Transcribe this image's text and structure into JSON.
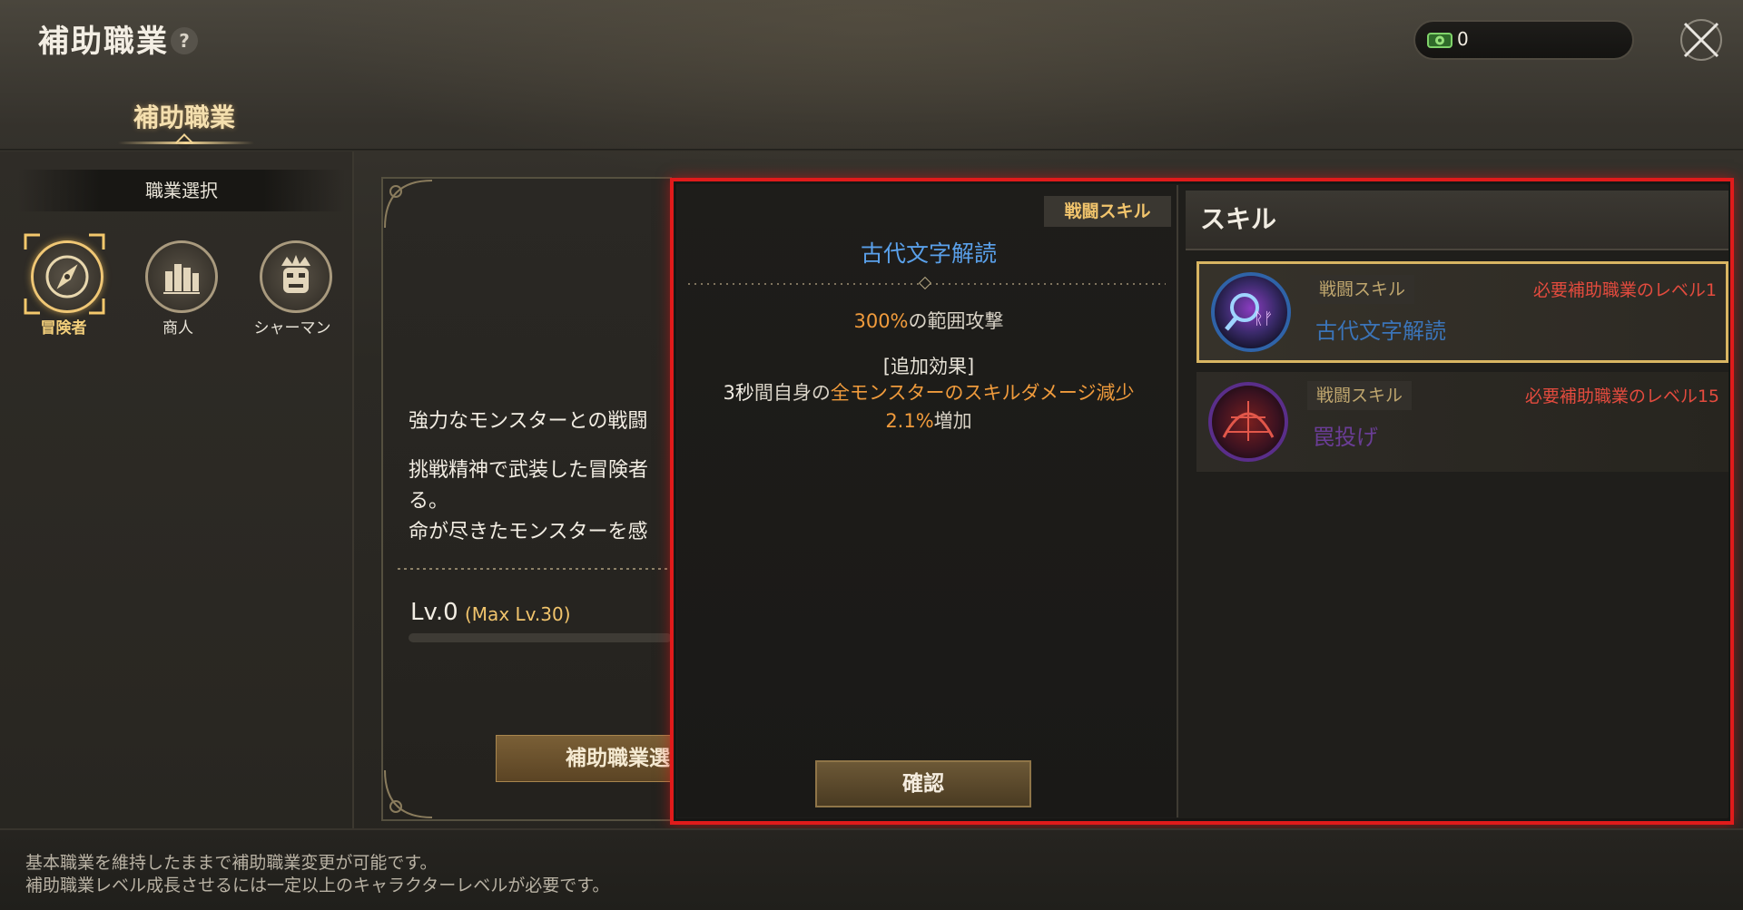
{
  "header": {
    "title": "補助職業",
    "help_symbol": "?",
    "currency_value": "0",
    "tab_label": "補助職業"
  },
  "left": {
    "heading": "職業選択",
    "jobs": [
      {
        "label": "冒険者",
        "selected": true
      },
      {
        "label": "商人",
        "selected": false
      },
      {
        "label": "シャーマン",
        "selected": false
      }
    ]
  },
  "middle": {
    "desc1": "強力なモンスターとの戦闘",
    "desc2": "挑戦精神で武装した冒険者",
    "desc3": "る。",
    "desc4": "命が尽きたモンスターを感",
    "level": "Lv.0",
    "level_max": "(Max Lv.30)",
    "select_button": "補助職業選"
  },
  "detail": {
    "badge": "戦闘スキル",
    "skill_name": "古代文字解読",
    "effect1_highlight": "300%",
    "effect1_rest": "の範囲攻撃",
    "extra_heading": "[追加効果]",
    "effect2_prefix": "3秒",
    "effect2_mid": "間自身の",
    "effect2_highlight": "全モンスターのスキルダメージ減少",
    "effect2_value": "2.1%",
    "effect2_suffix": "増加",
    "confirm_button": "確認"
  },
  "skill_list": {
    "heading": "スキル",
    "items": [
      {
        "badge": "戦闘スキル",
        "requirement": "必要補助職業のレベル1",
        "name": "古代文字解読",
        "name_color": "#3b74b8",
        "selected": true
      },
      {
        "badge": "戦闘スキル",
        "requirement": "必要補助職業のレベル15",
        "name": "罠投げ",
        "name_color": "#6a3d96",
        "selected": false
      }
    ]
  },
  "footer": {
    "line1": "基本職業を維持したままで補助職業変更が可能です。",
    "line2": "補助職業レベル成長させるには一定以上のキャラクターレベルが必要です。"
  },
  "colors": {
    "highlight_border": "#e01b1b",
    "accent_gold": "#f1c46c",
    "orange_text": "#f09b3c",
    "skill_name_blue": "#5aa0ea",
    "requirement_red": "#e34b3e"
  }
}
